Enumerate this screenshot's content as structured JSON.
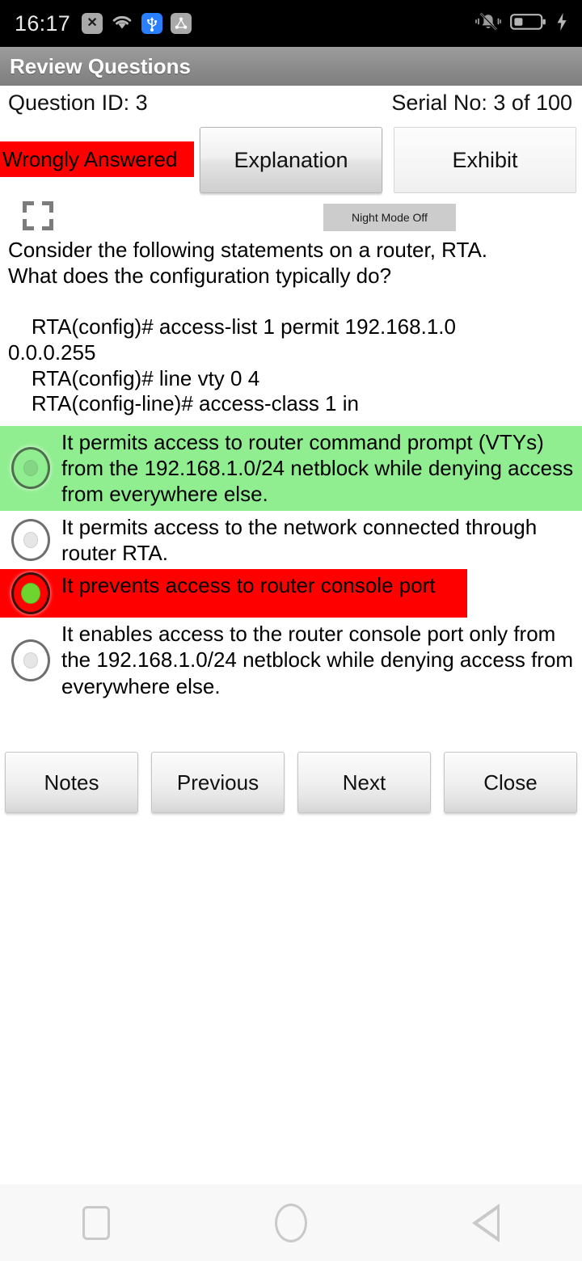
{
  "status_bar": {
    "time": "16:17",
    "left_icons": [
      {
        "name": "no-sim-icon",
        "glyph": "✕"
      },
      {
        "name": "wifi-icon",
        "glyph": ""
      },
      {
        "name": "usb-icon",
        "glyph": ""
      },
      {
        "name": "adb-debug-icon",
        "glyph": ""
      }
    ],
    "right_icons": [
      {
        "name": "silent-mode-icon"
      },
      {
        "name": "battery-icon"
      },
      {
        "name": "charging-bolt-icon"
      }
    ]
  },
  "title_bar": {
    "title": "Review Questions"
  },
  "meta": {
    "question_id": "Question ID: 3",
    "serial_no": "Serial No: 3 of 100"
  },
  "status_badge": {
    "label": "Wrongly Answered",
    "background": "#ff0000"
  },
  "top_buttons": {
    "explanation": "Explanation",
    "exhibit": "Exhibit"
  },
  "toolbar": {
    "fullscreen_icon": "fullscreen-icon",
    "night_mode": "Night Mode Off"
  },
  "question": {
    "text": "Consider the following statements on a router, RTA.\nWhat does the configuration typically do?\n\n    RTA(config)# access-list 1 permit 192.168.1.0\n0.0.0.255\n    RTA(config)# line vty 0 4\n    RTA(config-line)# access-class 1 in"
  },
  "options": [
    {
      "text": "It permits access to router command prompt (VTYs) from the 192.168.1.0/24 netblock while denying access from everywhere else.",
      "state": "correct",
      "selected": false,
      "background": "#90ee90"
    },
    {
      "text": "It permits access to the network connected through router RTA.",
      "state": "normal",
      "selected": false,
      "background": "#ffffff"
    },
    {
      "text": "It prevents access to router console port",
      "state": "wrong",
      "selected": true,
      "background": "#ff0000"
    },
    {
      "text": "It enables access to the router console port only from the 192.168.1.0/24 netblock while denying access from everywhere else.",
      "state": "normal",
      "selected": false,
      "background": "#ffffff"
    }
  ],
  "bottom_buttons": [
    {
      "label": "Notes",
      "name": "notes-button"
    },
    {
      "label": "Previous",
      "name": "previous-button"
    },
    {
      "label": "Next",
      "name": "next-button"
    },
    {
      "label": "Close",
      "name": "close-button"
    }
  ],
  "nav_bar": {
    "recents": "recents-button",
    "home": "home-button",
    "back": "back-button"
  }
}
